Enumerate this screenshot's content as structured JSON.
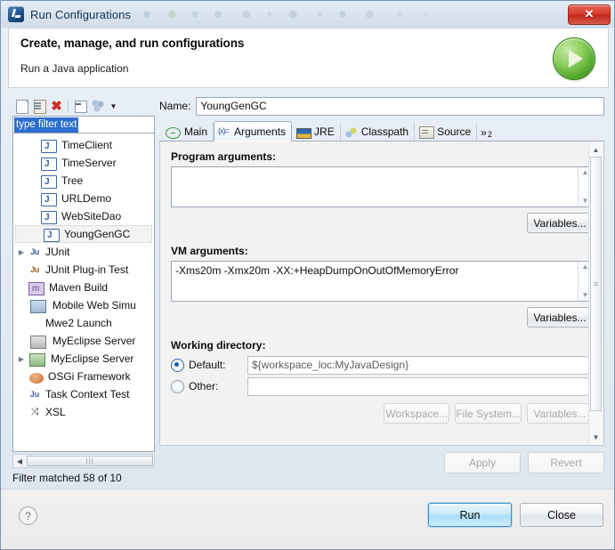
{
  "window": {
    "title": "Run Configurations",
    "app_icon": "eclipse-icon",
    "close_icon": "window-close-icon"
  },
  "header": {
    "title": "Create, manage, and run configurations",
    "subtitle": "Run a Java application",
    "icon": "run-green-play-icon"
  },
  "tree_toolbar": {
    "items": [
      {
        "icon": "new-launch-configuration-icon"
      },
      {
        "icon": "duplicate-configuration-icon"
      },
      {
        "icon": "delete-configuration-icon",
        "glyph": "✖"
      },
      {
        "icon": "collapse-all-icon"
      },
      {
        "icon": "filter-icon"
      },
      {
        "icon": "chevron-down-icon",
        "glyph": "▼"
      }
    ]
  },
  "filter": {
    "value": "type filter text",
    "placeholder": "type filter text",
    "status": "Filter matched 58 of 10"
  },
  "tree": {
    "items": [
      {
        "label": "TimeClient",
        "icon": "java-application-icon",
        "indent": 1,
        "expandable": false,
        "selected": false
      },
      {
        "label": "TimeServer",
        "icon": "java-application-icon",
        "indent": 1,
        "expandable": false,
        "selected": false
      },
      {
        "label": "Tree",
        "icon": "java-application-icon",
        "indent": 1,
        "expandable": false,
        "selected": false
      },
      {
        "label": "URLDemo",
        "icon": "java-application-icon",
        "indent": 1,
        "expandable": false,
        "selected": false
      },
      {
        "label": "WebSiteDao",
        "icon": "java-application-icon",
        "indent": 1,
        "expandable": false,
        "selected": false
      },
      {
        "label": "YoungGenGC",
        "icon": "java-application-icon",
        "indent": 1,
        "expandable": false,
        "selected": true
      },
      {
        "label": "JUnit",
        "icon": "junit-icon",
        "indent": 0,
        "expandable": true,
        "selected": false
      },
      {
        "label": "JUnit Plug-in Test",
        "icon": "junit-plugin-test-icon",
        "indent": 0,
        "expandable": false,
        "selected": false
      },
      {
        "label": "Maven Build",
        "icon": "maven-build-icon",
        "indent": 0,
        "expandable": false,
        "selected": false
      },
      {
        "label": "Mobile Web Simu",
        "icon": "mobile-web-simulator-icon",
        "indent": 0,
        "expandable": false,
        "selected": false
      },
      {
        "label": "Mwe2 Launch",
        "icon": "mwe2-launch-icon",
        "indent": 0,
        "expandable": false,
        "selected": false
      },
      {
        "label": "MyEclipse Server",
        "icon": "myeclipse-server-icon",
        "indent": 0,
        "expandable": false,
        "selected": false
      },
      {
        "label": "MyEclipse Server",
        "icon": "myeclipse-server-group-icon",
        "indent": 0,
        "expandable": true,
        "selected": false
      },
      {
        "label": "OSGi Framework",
        "icon": "osgi-framework-icon",
        "indent": 0,
        "expandable": false,
        "selected": false
      },
      {
        "label": "Task Context Test",
        "icon": "task-context-test-icon",
        "indent": 0,
        "expandable": false,
        "selected": false
      },
      {
        "label": "XSL",
        "icon": "xsl-icon",
        "indent": 0,
        "expandable": false,
        "selected": false
      }
    ]
  },
  "config": {
    "name_label": "Name:",
    "name_value": "YoungGenGC",
    "tabs": [
      {
        "label": "Main",
        "icon": "main-tab-icon",
        "active": false
      },
      {
        "label": "Arguments",
        "icon": "arguments-tab-icon",
        "active": true
      },
      {
        "label": "JRE",
        "icon": "jre-tab-icon",
        "active": false
      },
      {
        "label": "Classpath",
        "icon": "classpath-tab-icon",
        "active": false
      },
      {
        "label": "Source",
        "icon": "source-tab-icon",
        "active": false
      }
    ],
    "tab_overflow": {
      "glyph": "»",
      "count": "2"
    }
  },
  "arguments": {
    "program_args_label": "Program arguments:",
    "program_args_value": "",
    "program_variables_button": "Variables...",
    "vm_args_label": "VM arguments:",
    "vm_args_value": "-Xms20m -Xmx20m -XX:+HeapDumpOnOutOfMemoryError",
    "vm_variables_button": "Variables...",
    "working_dir_label": "Working directory:",
    "default_radio_label": "Default:",
    "default_value": "${workspace_loc:MyJavaDesign}",
    "other_radio_label": "Other:",
    "other_value": "",
    "workspace_button": "Workspace...",
    "file_system_button": "File System...",
    "variables_button": "Variables...",
    "selected_working_dir": "default"
  },
  "actions": {
    "apply": "Apply",
    "revert": "Revert",
    "run": "Run",
    "close": "Close",
    "help_icon": "help-question-icon"
  },
  "colors": {
    "accent": "#2b6ecf",
    "run_green": "#4fa527",
    "close_red": "#d83c2c",
    "primary_button": "#a9dcf4"
  }
}
